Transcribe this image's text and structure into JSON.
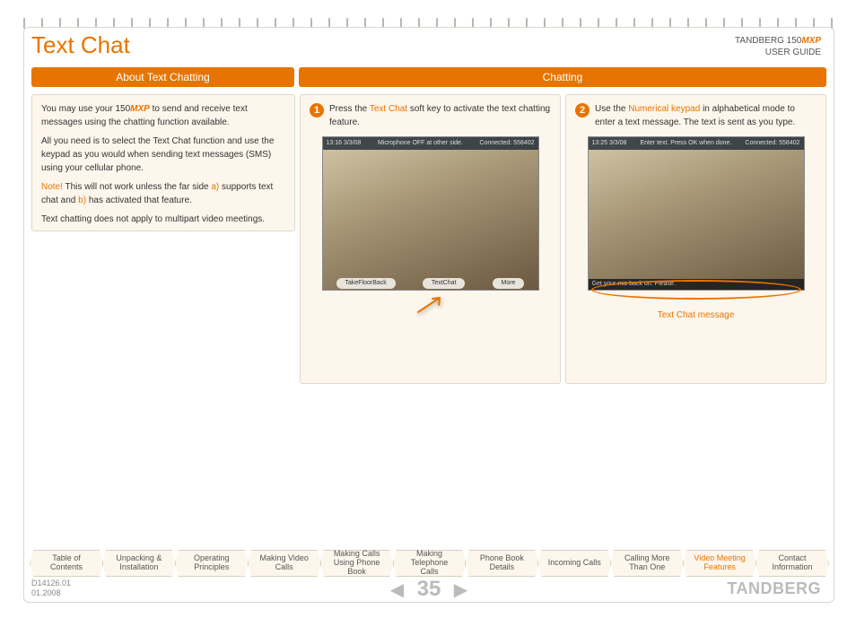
{
  "header": {
    "title": "Text Chat",
    "product_prefix": "TANDBERG 150",
    "product_suffix": "MXP",
    "subtitle": "USER GUIDE"
  },
  "tabs": {
    "left": "About Text Chatting",
    "right": "Chatting"
  },
  "about": {
    "p1a": "You may use your 150",
    "p1b": "MXP",
    "p1c": " to send and receive text messages using the chatting function available.",
    "p2": "All you need is to select the Text Chat function and use the keypad as you would when sending text messages (SMS) using your cellular phone.",
    "p3_note": "Note!",
    "p3a": " This will not work unless the far side ",
    "p3_a_label": "a)",
    "p3b": " supports text chat and ",
    "p3_b_label": "b)",
    "p3c": " has activated that feature.",
    "p4": "Text chatting does not apply to multipart video meetings."
  },
  "step1": {
    "num": "1",
    "pre": "Press the ",
    "key": "Text Chat",
    "post": " soft key to activate the text chatting feature.",
    "top_time": "13:16  3/3/08",
    "top_msg": "Microphone OFF at other side.",
    "top_conn": "Connected: 558402",
    "sk1": "TakeFloorBack",
    "sk2": "TextChat",
    "sk3": "More"
  },
  "step2": {
    "num": "2",
    "pre": "Use the ",
    "key": "Numerical keypad",
    "post": " in alphabetical mode to enter a text message. The text is sent as you type.",
    "top_time": "13:25  3/3/08",
    "top_msg": "Enter text. Press OK when done.",
    "top_conn": "Connected: 558402",
    "msgbar": "Get your mic back on. Please.",
    "caption": "Text Chat message"
  },
  "nav": {
    "items": [
      "Table of Contents",
      "Unpacking & Installation",
      "Operating Principles",
      "Making Video Calls",
      "Making Calls Using Phone Book",
      "Making Telephone Calls",
      "Phone Book Details",
      "Incoming Calls",
      "Calling More Than One",
      "Video Meeting Features",
      "Contact Information"
    ],
    "active_index": 9
  },
  "footer": {
    "doc": "D14126.01",
    "date": "01.2008",
    "page": "35",
    "brand": "TANDBERG"
  }
}
